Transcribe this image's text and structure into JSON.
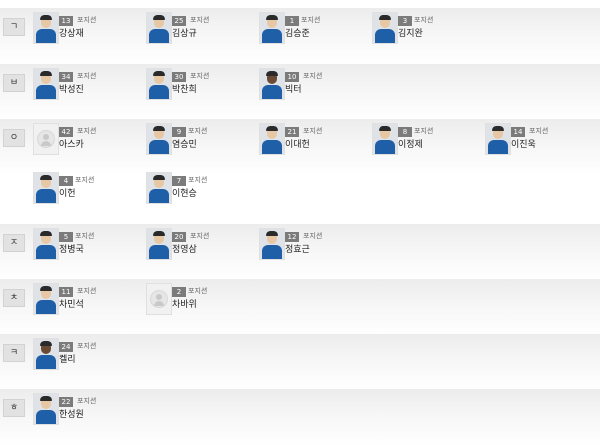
{
  "sections": [
    {
      "letter": "ㄱ",
      "players": [
        {
          "number": "13",
          "position": "포지션",
          "name": "강상재",
          "photo": "player-photo"
        },
        {
          "number": "25",
          "position": "포지션",
          "name": "김상규",
          "photo": "player-photo"
        },
        {
          "number": "1",
          "position": "포지션",
          "name": "김승준",
          "photo": "player-photo"
        },
        {
          "number": "3",
          "position": "포지션",
          "name": "김지완",
          "photo": "player-photo"
        }
      ]
    },
    {
      "letter": "ㅂ",
      "players": [
        {
          "number": "34",
          "position": "포지션",
          "name": "박성진",
          "photo": "player-photo"
        },
        {
          "number": "30",
          "position": "포지션",
          "name": "박찬희",
          "photo": "player-photo"
        },
        {
          "number": "10",
          "position": "포지션",
          "name": "빅터",
          "photo": "player-photo-dark"
        }
      ]
    },
    {
      "letter": "ㅇ",
      "players": [
        {
          "number": "42",
          "position": "포지션",
          "name": "아스카",
          "photo": "no-photo"
        },
        {
          "number": "9",
          "position": "포지션",
          "name": "염승민",
          "photo": "player-photo"
        },
        {
          "number": "21",
          "position": "포지션",
          "name": "이대헌",
          "photo": "player-photo"
        },
        {
          "number": "8",
          "position": "포지션",
          "name": "이정제",
          "photo": "player-photo"
        },
        {
          "number": "14",
          "position": "포지션",
          "name": "이진욱",
          "photo": "player-photo"
        },
        {
          "number": "4",
          "position": "포지션",
          "name": "이헌",
          "photo": "player-photo"
        },
        {
          "number": "7",
          "position": "포지션",
          "name": "이현승",
          "photo": "player-photo"
        }
      ]
    },
    {
      "letter": "ㅈ",
      "players": [
        {
          "number": "5",
          "position": "포지션",
          "name": "정병국",
          "photo": "player-photo"
        },
        {
          "number": "20",
          "position": "포지션",
          "name": "정영삼",
          "photo": "player-photo"
        },
        {
          "number": "12",
          "position": "포지션",
          "name": "정효근",
          "photo": "player-photo"
        }
      ]
    },
    {
      "letter": "ㅊ",
      "players": [
        {
          "number": "11",
          "position": "포지션",
          "name": "차민석",
          "photo": "player-photo"
        },
        {
          "number": "2",
          "position": "포지션",
          "name": "차바위",
          "photo": "no-photo"
        }
      ]
    },
    {
      "letter": "ㅋ",
      "players": [
        {
          "number": "24",
          "position": "포지션",
          "name": "켈리",
          "photo": "player-photo-dark"
        }
      ]
    },
    {
      "letter": "ㅎ",
      "players": [
        {
          "number": "22",
          "position": "포지션",
          "name": "한성원",
          "photo": "player-photo"
        }
      ]
    }
  ],
  "colors": {
    "jersey": "#1f5fa8",
    "number_badge": "#7b7b7b",
    "section_band": "#ececec"
  }
}
